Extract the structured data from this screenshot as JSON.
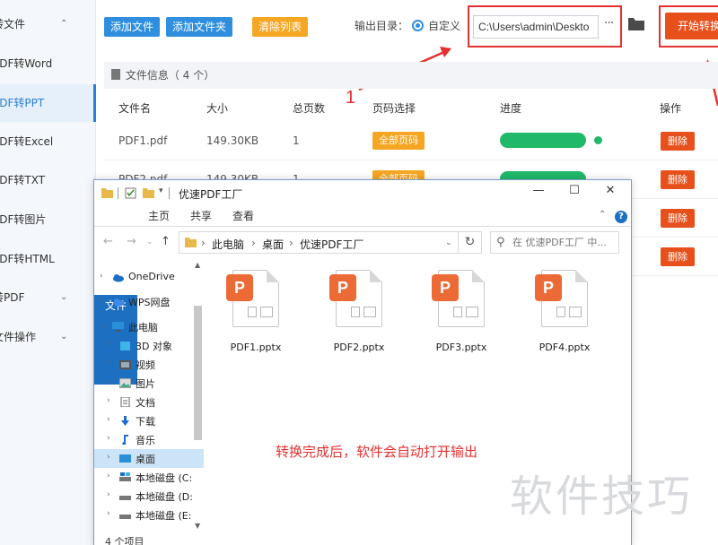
{
  "sidebar": {
    "items": [
      {
        "label": "转文件",
        "expand": "⌃"
      },
      {
        "label": "PDF转Word"
      },
      {
        "label": "PDF转PPT",
        "active": true
      },
      {
        "label": "PDF转Excel"
      },
      {
        "label": "PDF转TXT"
      },
      {
        "label": "PDF转图片"
      },
      {
        "label": "PDF转HTML"
      },
      {
        "label": "转PDF",
        "expand": "⌄"
      },
      {
        "label": "文件操作",
        "expand": "⌄"
      }
    ]
  },
  "toolbar": {
    "add_file": "添加文件",
    "add_folder": "添加文件夹",
    "clear_list": "清除列表",
    "output_label": "输出目录：",
    "custom_label": "自定义",
    "output_path": "C:\\Users\\admin\\Deskto",
    "more": "···",
    "start": "开始转换"
  },
  "file_table": {
    "info_label": "文件信息（ 4 个）",
    "headers": [
      "文件名",
      "大小",
      "总页数",
      "页码选择",
      "进度",
      "操作"
    ],
    "rows": [
      {
        "name": "PDF1.pdf",
        "size": "149.30KB",
        "pages": "1",
        "page_select": "全部页码",
        "progress": 1.0,
        "action": "删除"
      },
      {
        "name": "PDF2.pdf",
        "size": "149.30KB",
        "pages": "1",
        "page_select": "全部页码",
        "progress": 1.0,
        "action": "删除"
      },
      {
        "name": "",
        "size": "",
        "pages": "",
        "page_select": "",
        "progress": null,
        "action": "删除"
      },
      {
        "name": "",
        "size": "",
        "pages": "",
        "page_select": "",
        "progress": null,
        "action": "删除"
      }
    ]
  },
  "annotations": {
    "step_number": "1",
    "note": "转换完成后，软件会自动打开输出",
    "watermark": "软件技巧"
  },
  "explorer": {
    "title": "优速PDF工厂",
    "ribbon_tabs": [
      "文件",
      "主页",
      "共享",
      "查看"
    ],
    "help": "?",
    "breadcrumb": [
      "此电脑",
      "桌面",
      "优速PDF工厂"
    ],
    "search_placeholder": "在 优速PDF工厂 中...",
    "nav_items": [
      {
        "label": "OneDrive",
        "icon": "cloud-icon"
      },
      {
        "label": "WPS网盘",
        "icon": "cloud-icon"
      },
      {
        "label": "此电脑",
        "icon": "computer-icon"
      },
      {
        "label": "3D 对象",
        "icon": "cube-icon"
      },
      {
        "label": "视频",
        "icon": "video-icon"
      },
      {
        "label": "图片",
        "icon": "picture-icon"
      },
      {
        "label": "文档",
        "icon": "document-icon"
      },
      {
        "label": "下载",
        "icon": "download-icon"
      },
      {
        "label": "音乐",
        "icon": "music-icon"
      },
      {
        "label": "桌面",
        "icon": "desktop-icon"
      },
      {
        "label": "本地磁盘 (C:",
        "icon": "drive-icon"
      },
      {
        "label": "本地磁盘 (D:",
        "icon": "drive-icon"
      },
      {
        "label": "本地磁盘 (E:",
        "icon": "drive-icon"
      }
    ],
    "files": [
      {
        "name": "PDF1.pptx",
        "icon": "pptx-file-icon"
      },
      {
        "name": "PDF2.pptx",
        "icon": "pptx-file-icon"
      },
      {
        "name": "PDF3.pptx",
        "icon": "pptx-file-icon"
      },
      {
        "name": "PDF4.pptx",
        "icon": "pptx-file-icon"
      }
    ],
    "status": "4 个项目"
  },
  "colors": {
    "accent_blue": "#2f8fde",
    "accent_orange": "#f5a623",
    "danger": "#e7501b",
    "success": "#20b96a",
    "annotation_red": "#e53030"
  }
}
